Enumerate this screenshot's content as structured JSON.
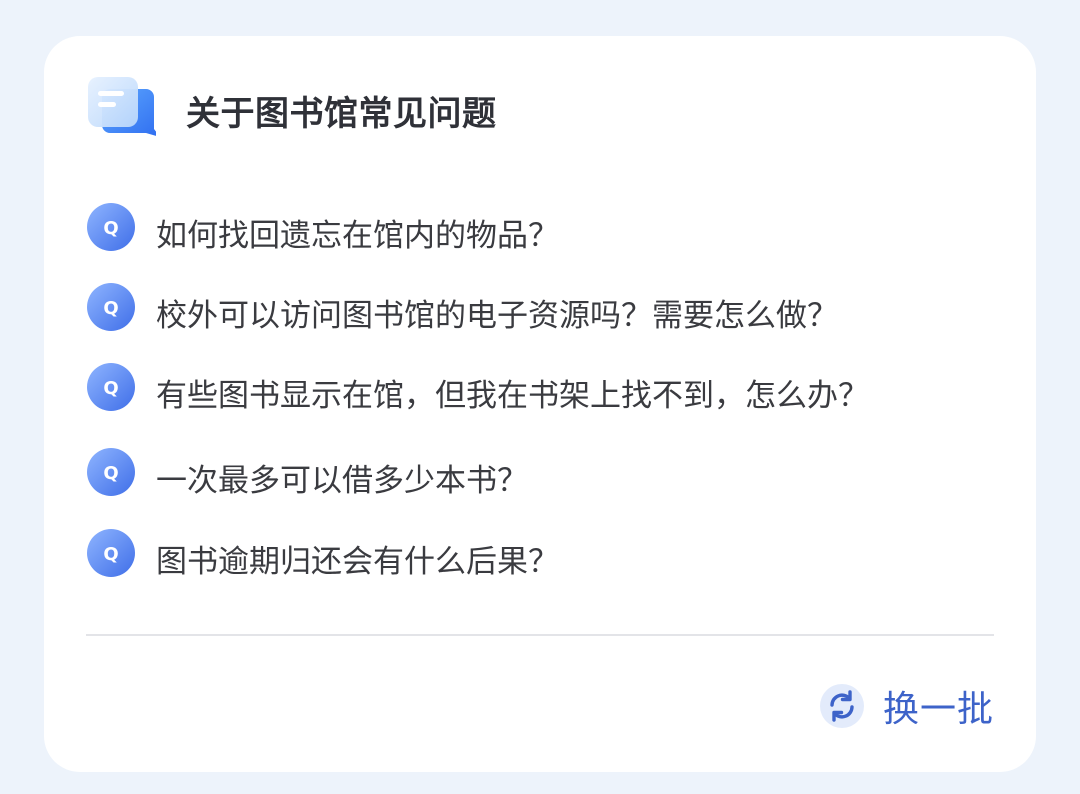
{
  "header": {
    "title": "关于图书馆常见问题",
    "icon": "chat-bubble-icon"
  },
  "faq": {
    "badge_letter": "Q",
    "items": [
      {
        "label": "如何找回遗忘在馆内的物品？"
      },
      {
        "label": "校外可以访问图书馆的电子资源吗？需要怎么做？"
      },
      {
        "label": "有些图书显示在馆，但我在书架上找不到，怎么办？"
      },
      {
        "label": "一次最多可以借多少本书？"
      },
      {
        "label": "图书逾期归还会有什么后果？"
      }
    ]
  },
  "footer": {
    "refresh_label": "换一批",
    "refresh_icon": "refresh-icon"
  },
  "colors": {
    "accent": "#3d63c9",
    "badge": "#4f7ff0",
    "background": "#edf3fb",
    "card": "#ffffff"
  }
}
